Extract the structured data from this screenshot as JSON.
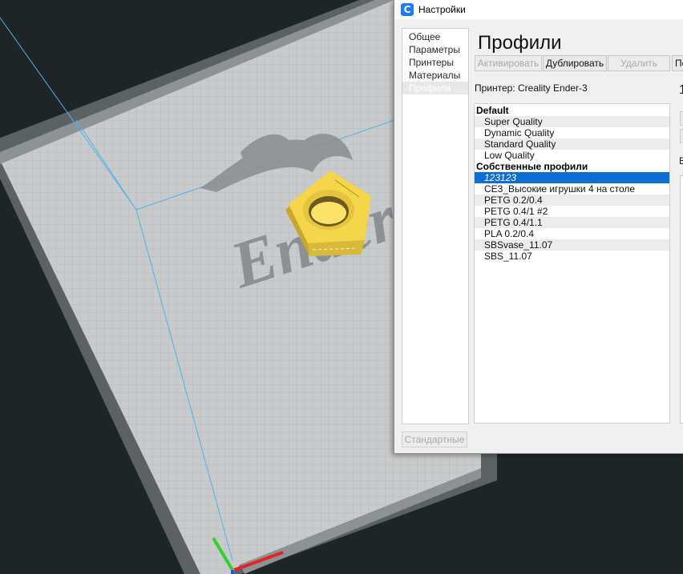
{
  "dialog": {
    "title": "Настройки",
    "app_icon": "cura-logo-icon",
    "nav": {
      "items": [
        "Общее",
        "Параметры",
        "Принтеры",
        "Материалы",
        "Профили"
      ],
      "selected_index": 4
    },
    "page_title": "Профили",
    "toolbar": {
      "activate": "Активировать",
      "duplicate": "Дублировать",
      "remove": "Удалить",
      "partial": "Пе"
    },
    "printer_label": "Принтер: Creality Ender-3",
    "profile_list": {
      "default_header": "Default",
      "default_profiles": [
        "Super Quality",
        "Dynamic Quality",
        "Standard Quality",
        "Low Quality"
      ],
      "custom_header": "Собственные профили",
      "custom_profiles": [
        "123123",
        "CE3_Высокие игрушки 4 на столе",
        "PETG 0.2/0.4",
        "PETG 0.4/1 #2",
        "PETG 0.4/1.1",
        "PLA 0.2/0.4",
        "SBSvase_11.07",
        "SBS_11.07"
      ],
      "selected": "123123"
    },
    "reset_button": "Стандартные",
    "right_partial_text": "1",
    "right_partial_letter": "В"
  },
  "viewport": {
    "bed_logo_text": "Ender",
    "model_color": "#f5d64a",
    "accent_blue": "#0f6ed3"
  }
}
